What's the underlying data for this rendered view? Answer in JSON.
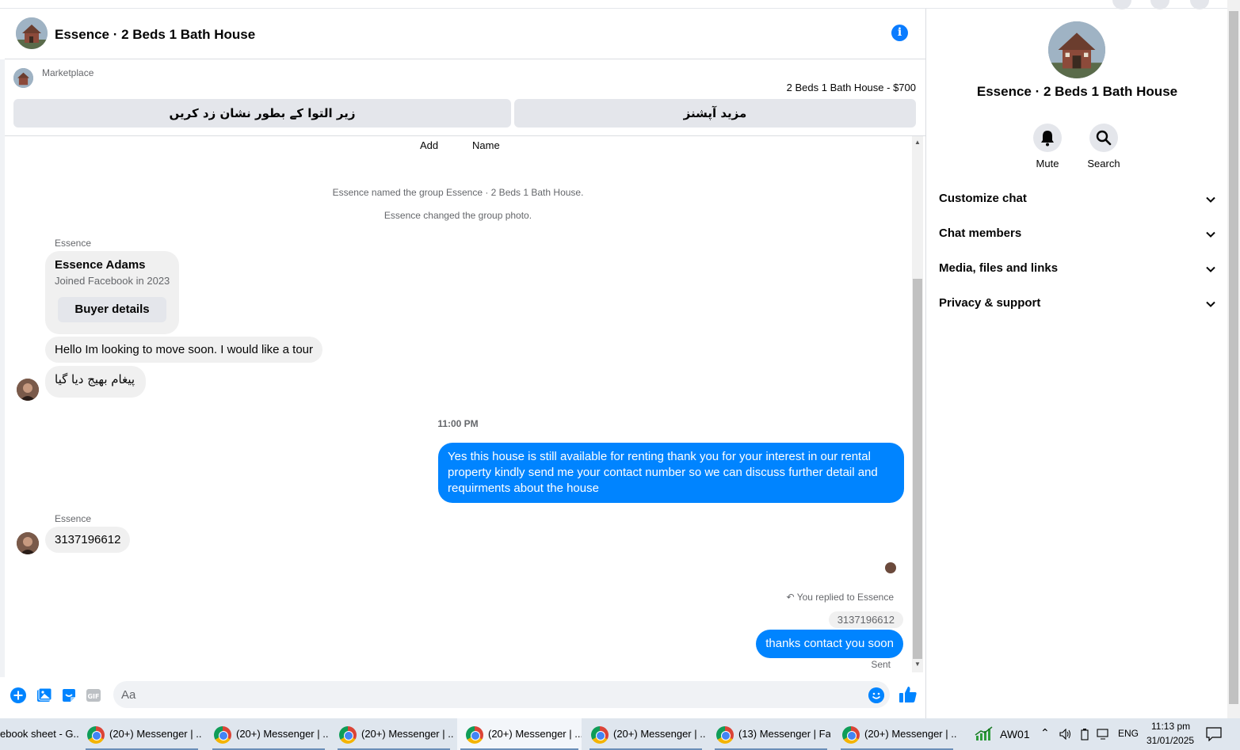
{
  "header": {
    "title": "Essence · 2 Beds 1 Bath House",
    "info_icon": "info-icon"
  },
  "marketplace": {
    "label": "Marketplace",
    "listing": "2 Beds 1 Bath House - $700",
    "mark_pending_label": "زیر التوا کے بطور نشان زد کریں",
    "more_options_label": "مزید آپشنز"
  },
  "messages": {
    "top_links": [
      "Add",
      "Name"
    ],
    "system": [
      "Essence named the group Essence · 2 Beds 1 Bath House.",
      "Essence changed the group photo."
    ],
    "sender_name": "Essence",
    "buyer_card": {
      "name": "Essence Adams",
      "joined": "Joined Facebook in 2023",
      "button": "Buyer details"
    },
    "incoming_1": "Hello Im looking to move soon. I would like a tour",
    "incoming_2": "پیغام بھیج دیا گیا",
    "timestamp": "11:00 PM",
    "outgoing_1": "Yes this house is still available for renting thank you for your interest in our rental property kindly send me your contact number so we can discuss further detail and requirments about the house",
    "sender_name_2": "Essence",
    "incoming_3": "3137196612",
    "reply_note": "You replied to Essence",
    "quoted": "3137196612",
    "outgoing_2": "thanks contact you soon",
    "status": "Sent"
  },
  "composer": {
    "placeholder": "Aa"
  },
  "right_panel": {
    "title": "Essence · 2 Beds 1 Bath House",
    "actions": [
      {
        "label": "Mute",
        "icon": "bell-icon"
      },
      {
        "label": "Search",
        "icon": "search-icon"
      }
    ],
    "sections": [
      "Customize chat",
      "Chat members",
      "Media, files and links",
      "Privacy & support"
    ]
  },
  "taskbar": {
    "items": [
      "ebook sheet - G...",
      "(20+) Messenger | ...",
      "(20+) Messenger | ...",
      "(20+) Messenger | ...",
      "(20+) Messenger | ...",
      "(20+) Messenger | ...",
      "(13) Messenger | Fa...",
      "(20+) Messenger | ..."
    ],
    "stock": "AW01",
    "lang": "ENG",
    "time": "11:13 pm",
    "date": "31/01/2025"
  },
  "colors": {
    "accent": "#0084ff",
    "bubble_gray": "#f0f0f0",
    "button_gray": "#e4e6eb",
    "secondary_text": "#65676b"
  }
}
